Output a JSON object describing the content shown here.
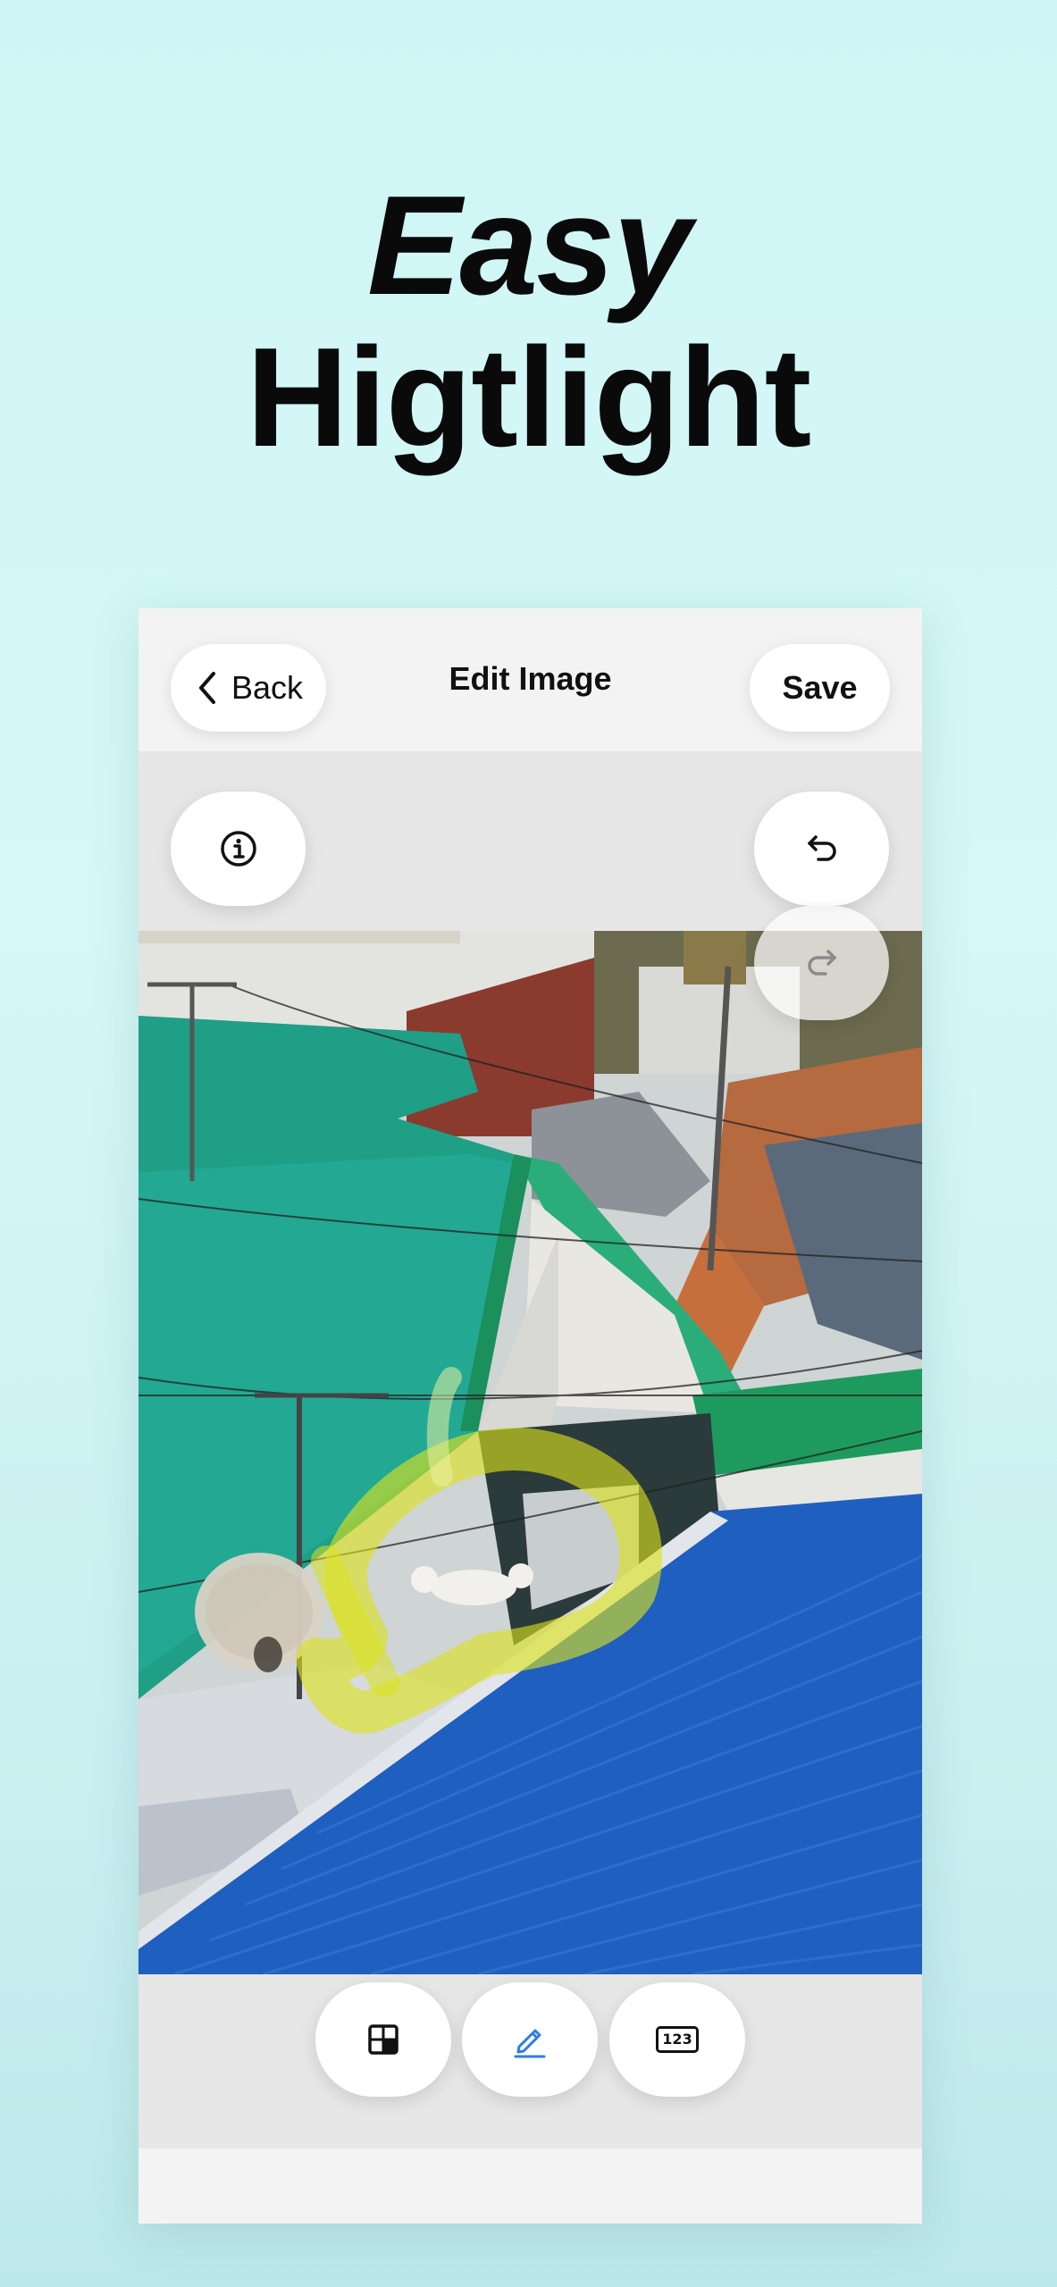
{
  "headline": {
    "line1": "Easy",
    "line2": "Higtlight"
  },
  "header": {
    "back_label": "Back",
    "title": "Edit Image",
    "save_label": "Save"
  },
  "icons": {
    "back": "chevron-left-icon",
    "info": "info-circle-icon",
    "undo": "undo-icon",
    "redo": "redo-icon",
    "grid": "grid-icon",
    "pen": "pencil-icon",
    "numbers": "numbers-icon"
  },
  "toolbar": {
    "numbers_label": "123",
    "active_tool": "pen"
  },
  "colors": {
    "background": "#cff6f6",
    "active_tool": "#2f7de1",
    "highlight": "#d6e21b"
  }
}
